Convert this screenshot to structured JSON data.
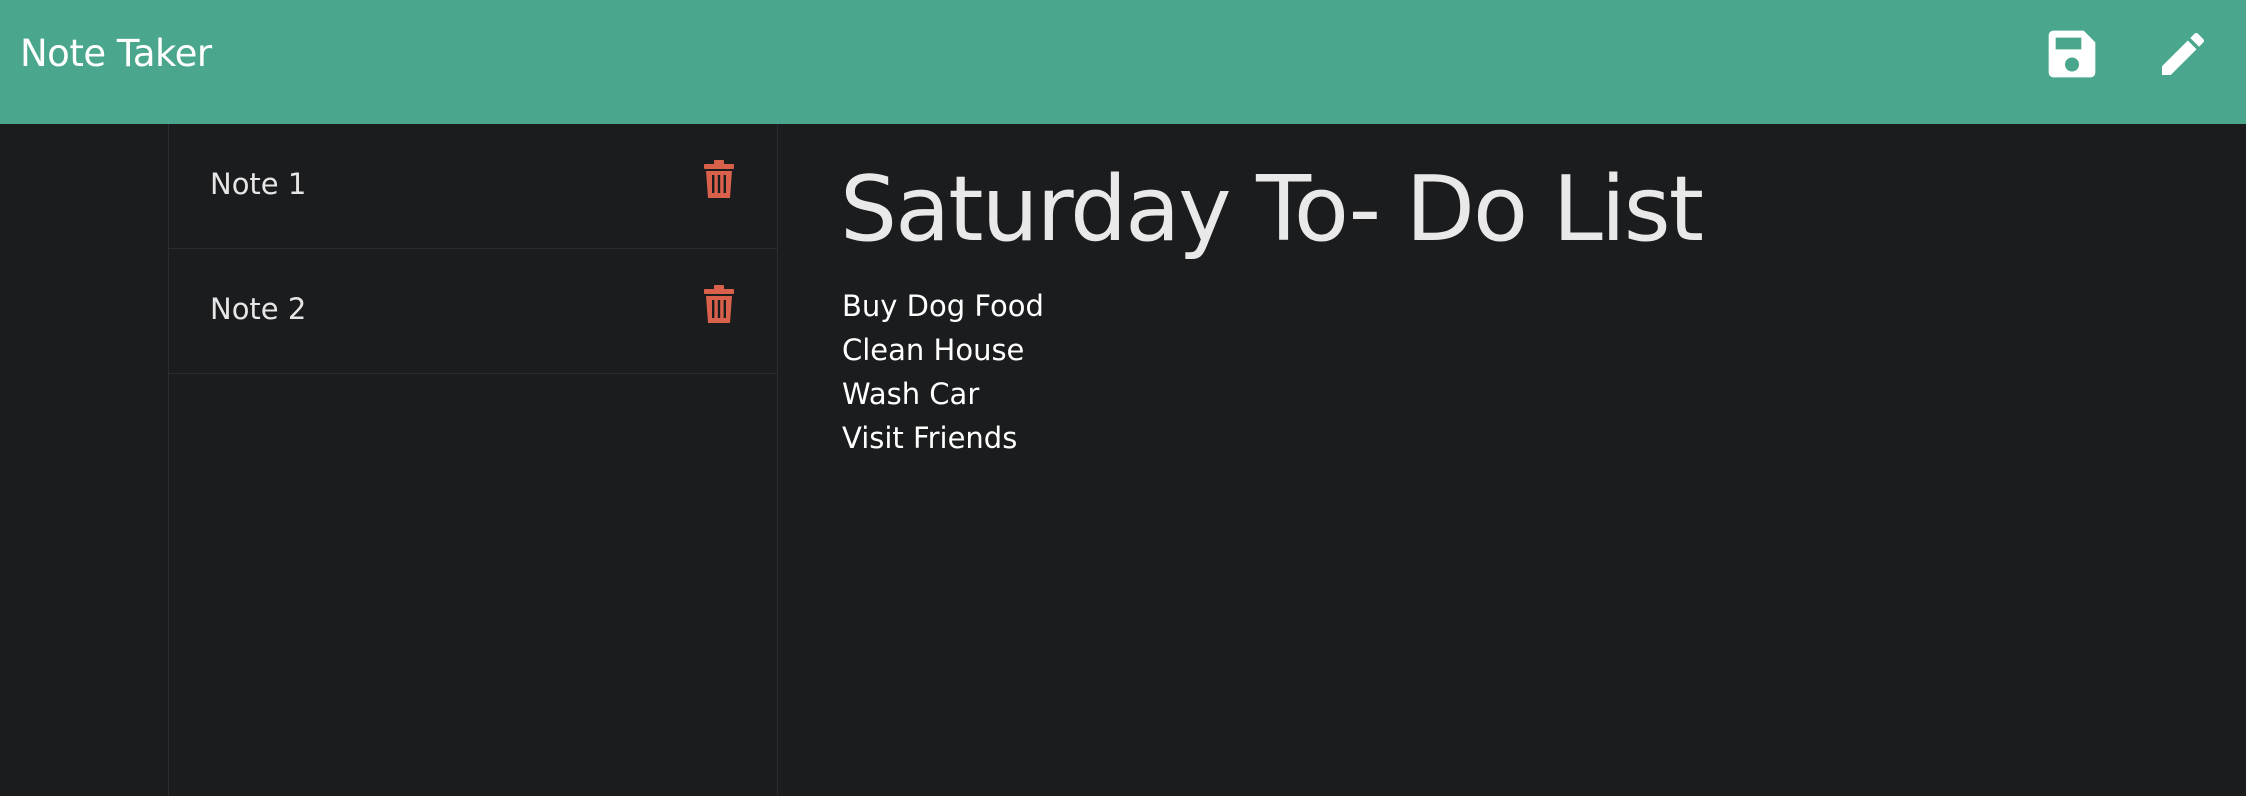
{
  "app": {
    "title": "Note Taker"
  },
  "header": {
    "icons": [
      "save-icon",
      "pencil-icon"
    ],
    "background": "#4aa68d"
  },
  "sidebar": {
    "items": [
      {
        "label": "Note 1",
        "icon": "trash-icon"
      },
      {
        "label": "Note 2",
        "icon": "trash-icon"
      }
    ]
  },
  "editor": {
    "title": "Saturday To- Do List",
    "lines": [
      "Buy Dog Food",
      "Clean House",
      "Wash Car",
      "Visit Friends"
    ]
  },
  "colors": {
    "accent": "#4aa68d",
    "background": "#1b1c1e",
    "delete": "#d9604b",
    "text": "#ececec"
  }
}
